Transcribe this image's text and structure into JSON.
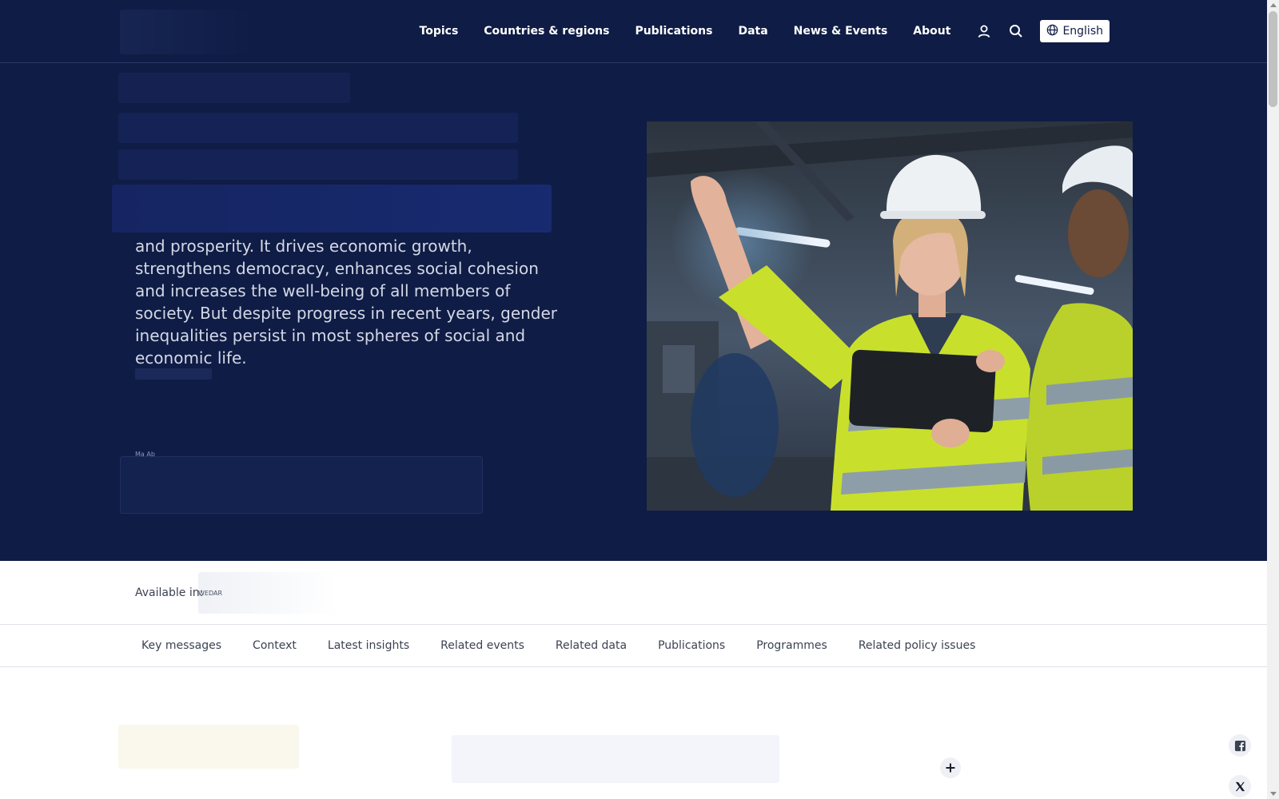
{
  "header": {
    "nav": [
      "Topics",
      "Countries & regions",
      "Publications",
      "Data",
      "News & Events",
      "About"
    ],
    "icons": [
      "user-icon",
      "search-icon",
      "globe-icon"
    ],
    "language": "English"
  },
  "hero": {
    "text": "and prosperity. It drives economic growth, strengthens democracy, enhances social cohesion and increases the well-being of all members of society. But despite progress in recent years, gender inequalities persist in most spheres of social and economic life.",
    "tiny_label": "Ma Ab"
  },
  "available": {
    "label": "Available in:",
    "value": "WEDAR"
  },
  "subnav": [
    "Key messages",
    "Context",
    "Latest insights",
    "Related events",
    "Related data",
    "Publications",
    "Programmes",
    "Related policy issues"
  ],
  "colors": {
    "header_bg": "#0f1c45",
    "hero_text": "#d3d8e6",
    "hi_vis_yellow": "#c8e02c"
  }
}
